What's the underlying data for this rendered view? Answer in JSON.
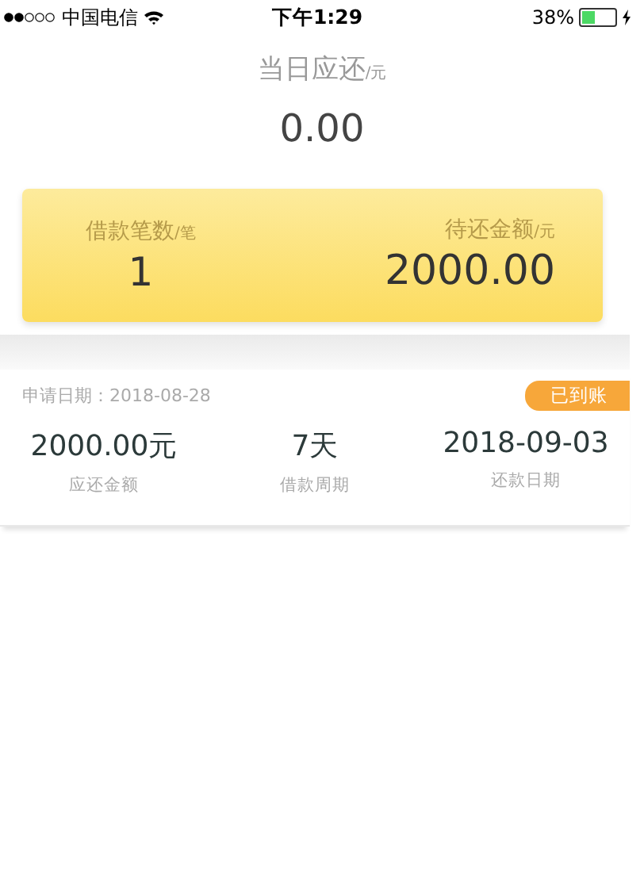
{
  "status_bar": {
    "carrier": "中国电信",
    "time": "下午1:29",
    "battery_percent": "38%"
  },
  "today_due": {
    "label": "当日应还",
    "unit": "/元",
    "amount": "0.00"
  },
  "summary_card": {
    "items": [
      {
        "label": "借款笔数",
        "unit": "/笔",
        "value": "1"
      },
      {
        "label": "待还金额",
        "unit": "/元",
        "value": "2000.00"
      }
    ]
  },
  "loans": [
    {
      "apply_date": "申请日期：2018-08-28",
      "status": "已到账",
      "fields": [
        {
          "value": "2000.00元",
          "label": "应还金额"
        },
        {
          "value": "7天",
          "label": "借款周期"
        },
        {
          "value": "2018-09-03",
          "label": "还款日期"
        }
      ]
    }
  ]
}
